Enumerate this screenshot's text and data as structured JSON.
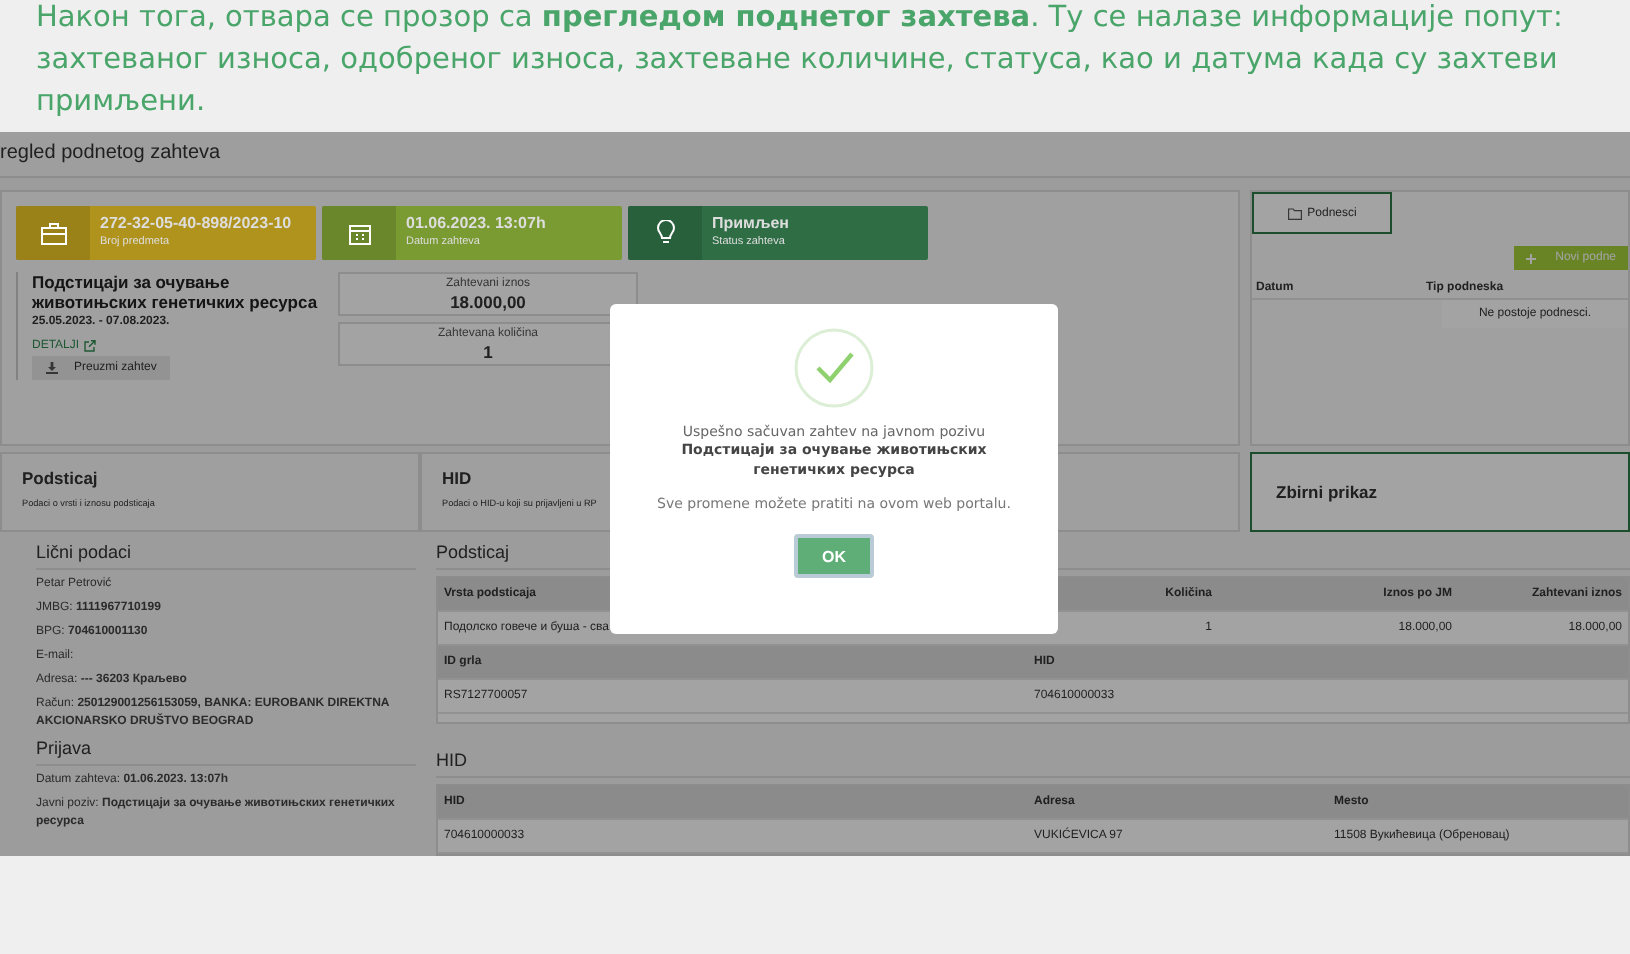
{
  "intro": {
    "text": "Након тога, отвара се прозор са **прегледом поднетог захтева**. Ту се налазе информације попут: захтеваног износа, одобреног износа, захтеване количине, статуса, као и датума када су захтеви примљени."
  },
  "app": {
    "page_title": "regled podnetog zahteva",
    "tiles": [
      {
        "kind": "case",
        "value": "272-32-05-40-898/2023-10",
        "label": "Broj predmeta",
        "color": "#b0931c"
      },
      {
        "kind": "date",
        "value": "01.06.2023. 13:07h",
        "label": "Datum zahteva",
        "color": "#7a9a32"
      },
      {
        "kind": "status",
        "value": "Примљен",
        "label": "Status zahteva",
        "color": "#2f6e45"
      }
    ],
    "request": {
      "title": "Подстицаји за очување животињских генетичких ресурса",
      "period": "25.05.2023. - 07.08.2023.",
      "details_link": "DETALJI",
      "download_button": "Preuzmi zahtev"
    },
    "amounts": [
      {
        "label": "Zahtevani iznos",
        "value": "18.000,00"
      },
      {
        "label": "Zahtevana količina",
        "value": "1"
      }
    ],
    "submissions": {
      "tab": "Podnesci",
      "new_button": "Novi podne",
      "columns": [
        "Datum",
        "Tip podneska"
      ],
      "empty_message": "Ne postoje podnesci."
    },
    "sections": [
      {
        "title": "Podsticaj",
        "subtitle": "Podaci o vrsti i iznosu podsticaja"
      },
      {
        "title": "HID",
        "subtitle": "Podaci o HID-u koji su prijavljeni u RP"
      }
    ],
    "summary": {
      "title": "Zbirni prikaz"
    },
    "personal": {
      "heading": "Lični podaci",
      "lines": [
        "Petar Petrović",
        "JMBG: **1111967710199**",
        "BPG: **704610001130**",
        "E-mail:",
        "Adresa: **--- 36203 Краљево**",
        "Račun: **250129001256153059, BANKA: EUROBANK DIREKTNA AKCIONARSKO DRUŠTVO BEOGRAD**"
      ]
    },
    "application": {
      "heading": "Prijava",
      "lines": [
        "Datum zahteva: **01.06.2023. 13:07h**",
        "Javni poziv: **Подстицаји за очување животињских генетичких ресурса**"
      ]
    },
    "incentive": {
      "heading": "Podsticaj",
      "columns": [
        "Vrsta podsticaja",
        "Količina",
        "Iznos po JM",
        "Zahtevani iznos"
      ],
      "rows": [
        [
          "Подолско говече и буша - сва",
          "1",
          "18.000,00",
          "18.000,00"
        ]
      ],
      "animal_columns": [
        "ID grla",
        "HID"
      ],
      "animal_rows": [
        [
          "RS7127700057",
          "704610000033"
        ]
      ]
    },
    "hid": {
      "heading": "HID",
      "columns": [
        "HID",
        "Adresa",
        "Mesto"
      ],
      "rows": [
        [
          "704610000033",
          "VUKIĆEVICA 97",
          "11508 Вукићевица (Обреновац)"
        ]
      ]
    }
  },
  "dialog": {
    "message": "Uspešno sačuvan zahtev na javnom pozivu",
    "call_name": "Подстицаји за очување животињских генетичких ресурса",
    "note": "Sve promene možete pratiti na ovom web portalu.",
    "ok_button": "OK"
  }
}
